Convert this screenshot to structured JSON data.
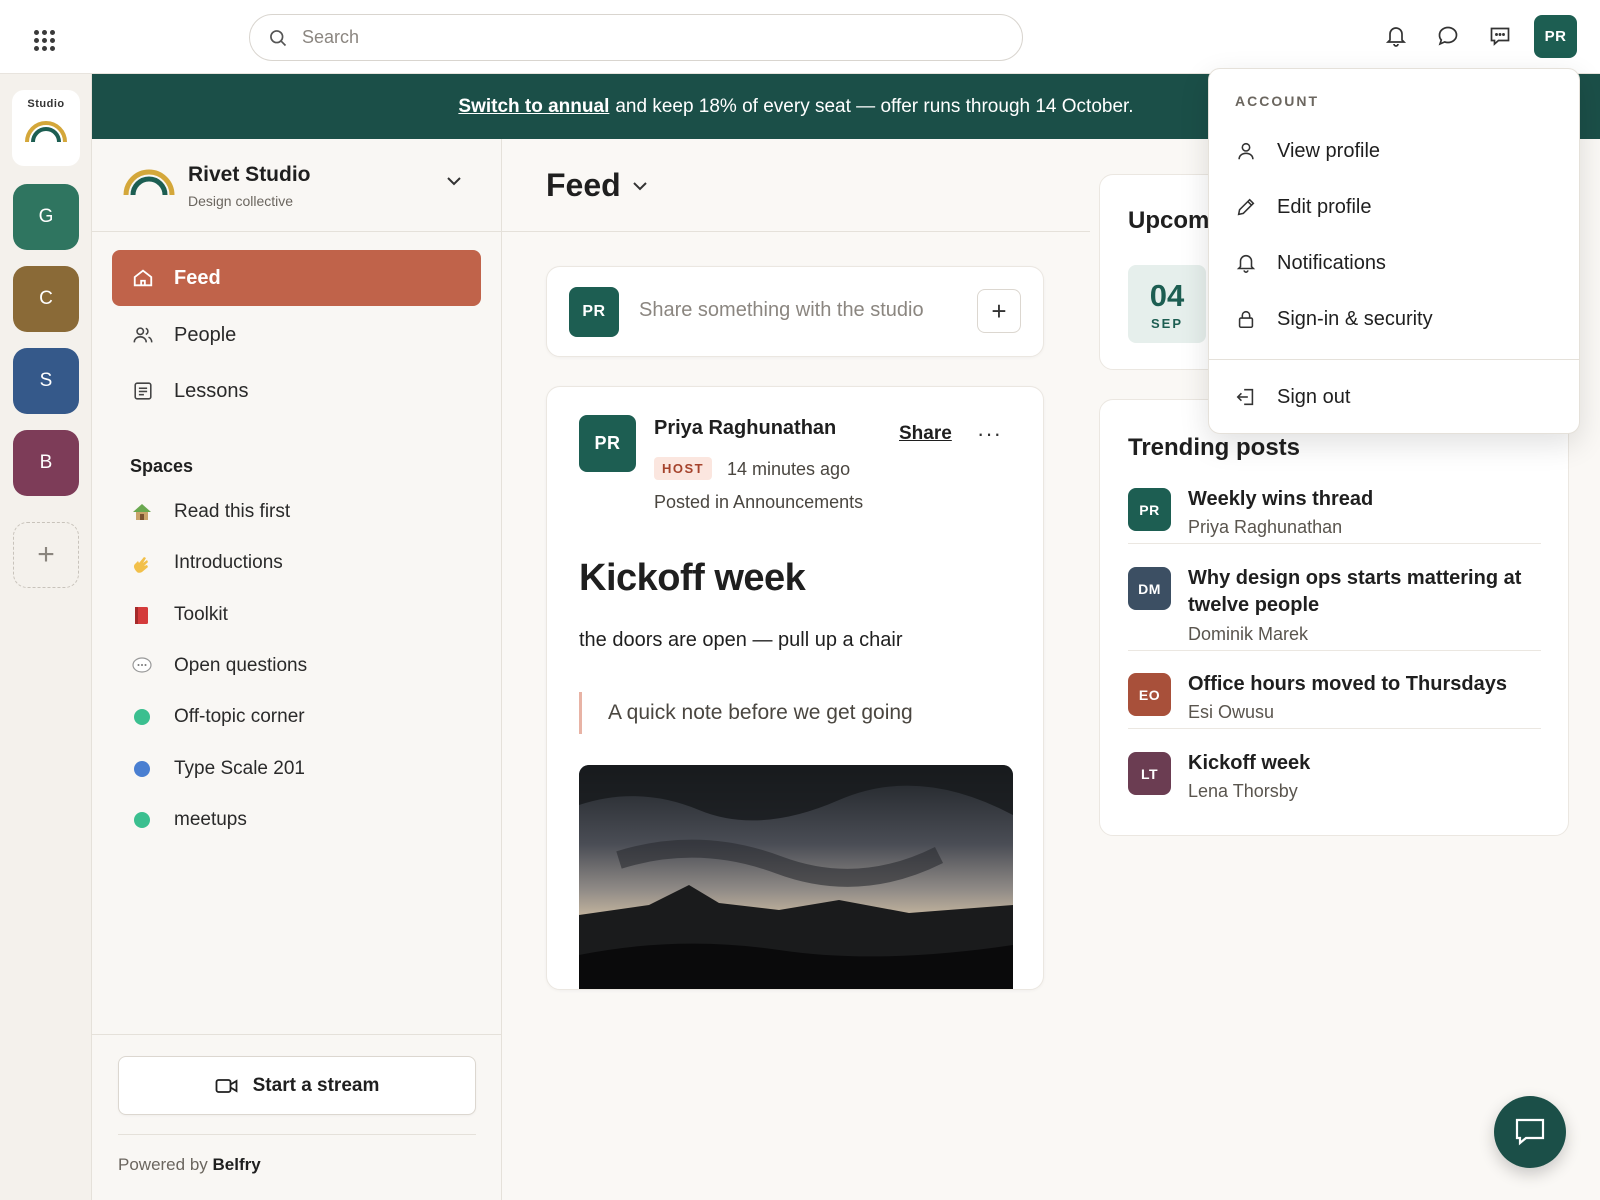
{
  "topbar": {
    "search_placeholder": "Search",
    "avatar_initials": "PR",
    "icons": [
      "apps-grid-icon",
      "search-icon",
      "bell-icon",
      "chat-bubble-icon",
      "message-square-icon"
    ]
  },
  "banner": {
    "link_text": "Switch to annual",
    "text": "and keep 18% of every seat — offer runs through 14 October."
  },
  "rail": {
    "studio_label": "Studio",
    "communities": [
      {
        "letter": "G",
        "color": "#2f7560"
      },
      {
        "letter": "C",
        "color": "#8a6a37"
      },
      {
        "letter": "S",
        "color": "#35598a"
      },
      {
        "letter": "B",
        "color": "#7d3c58"
      }
    ],
    "add_label": "+"
  },
  "sidebar": {
    "brand_name": "Rivet Studio",
    "brand_sub": "Design collective",
    "nav": [
      {
        "label": "Feed",
        "icon": "home-icon",
        "active": true
      },
      {
        "label": "People",
        "icon": "people-icon",
        "active": false
      },
      {
        "label": "Lessons",
        "icon": "lessons-icon",
        "active": false
      }
    ],
    "spaces_title": "Spaces",
    "spaces": [
      {
        "label": "Read this first",
        "icon": "hut-emoji"
      },
      {
        "label": "Introductions",
        "icon": "wave-emoji"
      },
      {
        "label": "Toolkit",
        "icon": "book-emoji"
      },
      {
        "label": "Open questions",
        "icon": "speech-emoji"
      },
      {
        "label": "Off-topic corner",
        "icon": "dot",
        "color": "#3bbf8f"
      },
      {
        "label": "Type Scale 201",
        "icon": "dot",
        "color": "#4a7fd1"
      },
      {
        "label": "meetups",
        "icon": "dot",
        "color": "#3bbf8f"
      }
    ],
    "stream_button": "Start a stream",
    "powered_prefix": "Powered by",
    "powered_brand": "Belfry"
  },
  "feed": {
    "title": "Feed",
    "composer_avatar": "PR",
    "composer_placeholder": "Share something with the studio",
    "composer_plus": "+",
    "post": {
      "avatar": "PR",
      "author": "Priya Raghunathan",
      "share": "Share",
      "more": "···",
      "badge": "HOST",
      "time": "14 minutes ago",
      "posted_in": "Posted in Announcements",
      "title": "Kickoff week",
      "body": "the doors are open — pull up a chair",
      "quote": "A quick note before we get going"
    }
  },
  "upcoming": {
    "title": "Upcom",
    "day": "04",
    "month": "SEP"
  },
  "trending": {
    "title": "Trending posts",
    "items": [
      {
        "initials": "PR",
        "color": "#1d5e52",
        "title": "Weekly wins thread",
        "author": "Priya Raghunathan"
      },
      {
        "initials": "DM",
        "color": "#3c4f63",
        "title": "Why design ops starts mattering at twelve people",
        "author": "Dominik Marek"
      },
      {
        "initials": "EO",
        "color": "#a8503a",
        "title": "Office hours moved to Thursdays",
        "author": "Esi Owusu"
      },
      {
        "initials": "LT",
        "color": "#6b3d52",
        "title": "Kickoff week",
        "author": "Lena Thorsby"
      }
    ]
  },
  "account_menu": {
    "heading": "ACCOUNT",
    "items": [
      {
        "label": "View profile",
        "icon": "user-icon"
      },
      {
        "label": "Edit profile",
        "icon": "pencil-icon"
      },
      {
        "label": "Notifications",
        "icon": "bell-icon"
      },
      {
        "label": "Sign-in & security",
        "icon": "lock-icon"
      }
    ],
    "sign_out": "Sign out"
  }
}
